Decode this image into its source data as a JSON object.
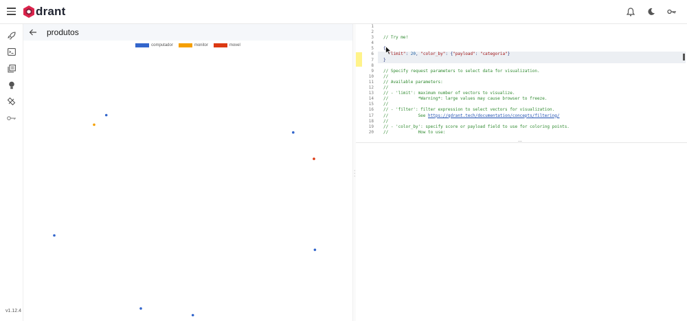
{
  "app": {
    "logo_text": "drant",
    "version": "v1.12.4"
  },
  "icons": {
    "menu": "hamburger-icon",
    "notifications": "bell-icon",
    "theme": "moon-icon",
    "api_key": "key-icon",
    "nav": [
      "rocket-icon",
      "console-icon",
      "collections-icon",
      "lightbulb-icon",
      "datasets-icon",
      "access-key-icon"
    ],
    "back": "arrow-left-icon"
  },
  "collection": {
    "title": "produtos"
  },
  "legend": [
    {
      "label": "computador",
      "color": "#3366cc"
    },
    {
      "label": "monitor",
      "color": "#f5a000"
    },
    {
      "label": "movel",
      "color": "#dc3912"
    }
  ],
  "points": [
    {
      "x": 0.252,
      "y": 0.228,
      "category": "computador"
    },
    {
      "x": 0.215,
      "y": 0.264,
      "category": "monitor"
    },
    {
      "x": 0.82,
      "y": 0.293,
      "category": "computador"
    },
    {
      "x": 0.883,
      "y": 0.392,
      "category": "movel"
    },
    {
      "x": 0.094,
      "y": 0.679,
      "category": "computador"
    },
    {
      "x": 0.886,
      "y": 0.733,
      "category": "computador"
    },
    {
      "x": 0.357,
      "y": 0.953,
      "category": "computador"
    },
    {
      "x": 0.515,
      "y": 0.978,
      "category": "computador"
    }
  ],
  "editor": {
    "lines": [
      {
        "n": "1",
        "text": ""
      },
      {
        "n": "2",
        "text": ""
      },
      {
        "n": "3",
        "text": "// Try me!"
      },
      {
        "n": "4",
        "text": ""
      },
      {
        "n": "5",
        "text": "{"
      },
      {
        "n": "6",
        "text": "  \"limit\": 20, \"color_by\": {\"payload\": \"categoria\"}"
      },
      {
        "n": "7",
        "text": "}"
      },
      {
        "n": "8",
        "text": ""
      },
      {
        "n": "9",
        "text": "// Specify request parameters to select data for visualization."
      },
      {
        "n": "10",
        "text": "//"
      },
      {
        "n": "11",
        "text": "// Available parameters:"
      },
      {
        "n": "12",
        "text": "//"
      },
      {
        "n": "13",
        "text": "// - 'limit': maximum number of vectors to visualize."
      },
      {
        "n": "14",
        "text": "//            *Warning*: large values may cause browser to freeze."
      },
      {
        "n": "15",
        "text": "//"
      },
      {
        "n": "16",
        "text": "// - 'filter': filter expression to select vectors for visualization."
      },
      {
        "n": "17",
        "text": "//            See https://qdrant.tech/documentation/concepts/filtering/"
      },
      {
        "n": "18",
        "text": "//"
      },
      {
        "n": "19",
        "text": "// - 'color_by': specify score or payload field to use for coloring points."
      },
      {
        "n": "20",
        "text": "//            How to use:"
      }
    ],
    "overflow_marker": "..."
  }
}
